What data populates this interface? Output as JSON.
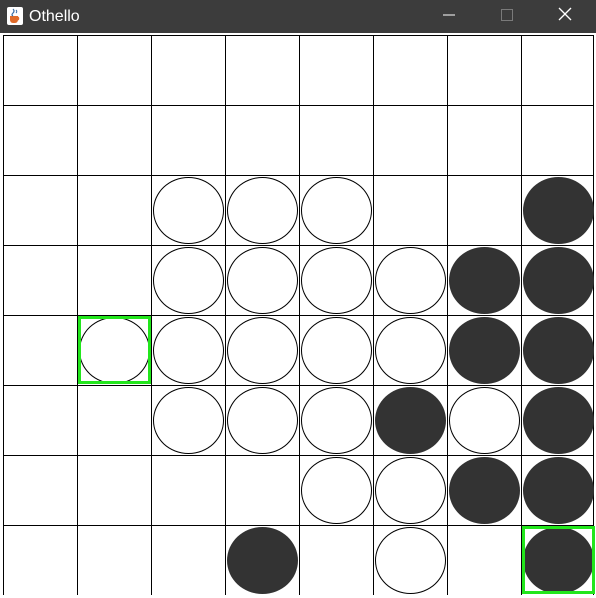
{
  "window": {
    "title": "Othello",
    "icon": "java-cup-icon",
    "titlebar_color": "#3c3c3c",
    "buttons": {
      "minimize": "minimize-icon",
      "maximize": "maximize-icon",
      "close": "close-icon"
    }
  },
  "board": {
    "rows": 8,
    "cols": 8,
    "colors": {
      "black": "#333333",
      "white": "#ffffff",
      "grid": "#000000",
      "highlight": "#22e61c"
    },
    "cells": [
      [
        "",
        "",
        "",
        "",
        "",
        "",
        "",
        ""
      ],
      [
        "",
        "",
        "",
        "",
        "",
        "",
        "",
        ""
      ],
      [
        "",
        "",
        "W",
        "W",
        "W",
        "",
        "",
        "B"
      ],
      [
        "",
        "",
        "W",
        "W",
        "W",
        "W",
        "B",
        "B"
      ],
      [
        "",
        "W",
        "W",
        "W",
        "W",
        "W",
        "B",
        "B"
      ],
      [
        "",
        "",
        "W",
        "W",
        "W",
        "B",
        "W",
        "B"
      ],
      [
        "",
        "",
        "",
        "",
        "W",
        "W",
        "B",
        "B"
      ],
      [
        "",
        "",
        "",
        "B",
        "",
        "W",
        "",
        "B"
      ]
    ],
    "highlighted": [
      {
        "row": 4,
        "col": 1
      },
      {
        "row": 7,
        "col": 7
      }
    ]
  }
}
